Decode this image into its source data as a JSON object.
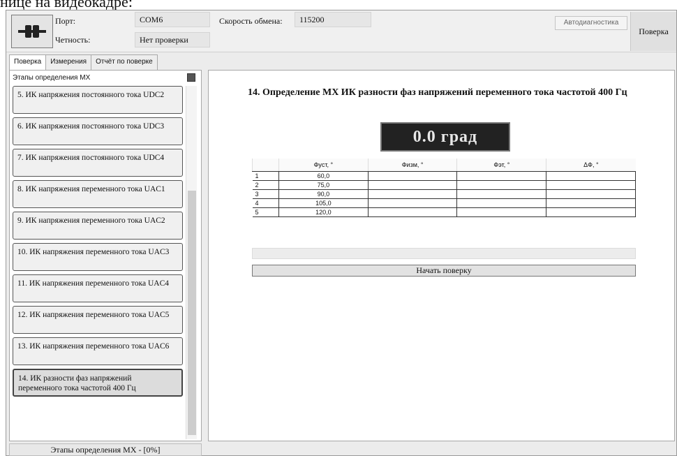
{
  "caption": "нице на видеокадре:",
  "toolbar": {
    "port_label": "Порт:",
    "port_value": "COM6",
    "parity_label": "Четность:",
    "parity_value": "Нет проверки",
    "baud_label": "Скорость обмена:",
    "baud_value": "115200",
    "autodiag_label": "Автодиагностика",
    "poverka_label": "Поверка"
  },
  "tabs": [
    "Поверка",
    "Измерения",
    "Отчёт по поверке"
  ],
  "left": {
    "header": "Этапы определения МХ",
    "steps": [
      "5. ИК напряжения постоянного тока UDC2",
      "6. ИК напряжения постоянного тока UDC3",
      "7. ИК напряжения постоянного тока UDC4",
      "8. ИК напряжения переменного тока UAC1",
      "9. ИК напряжения переменного тока UAC2",
      "10. ИК напряжения переменного тока UAC3",
      "11. ИК напряжения переменного тока UAC4",
      "12. ИК напряжения переменного тока UAC5",
      "13. ИК напряжения переменного тока UAC6",
      "14. ИК разности фаз напряжений переменного тока частотой 400 Гц"
    ],
    "status": "Этапы определения МХ - [0%]"
  },
  "main": {
    "title": "14. Определение МХ ИК разности фаз напряжений переменного тока частотой 400 Гц",
    "display": "0.0 град",
    "table": {
      "headers": [
        "",
        "Фуст, °",
        "Физм, °",
        "Фэт, °",
        "ΔФ, °"
      ],
      "rows": [
        [
          "1",
          "60,0",
          "",
          "",
          ""
        ],
        [
          "2",
          "75,0",
          "",
          "",
          ""
        ],
        [
          "3",
          "90,0",
          "",
          "",
          ""
        ],
        [
          "4",
          "105,0",
          "",
          "",
          ""
        ],
        [
          "5",
          "120,0",
          "",
          "",
          ""
        ]
      ]
    },
    "start_button": "Начать поверку"
  }
}
